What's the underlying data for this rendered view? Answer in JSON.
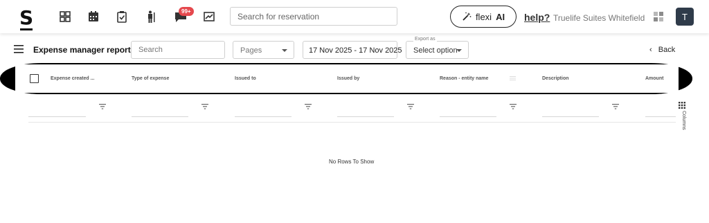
{
  "topbar": {
    "logo": "S",
    "notification_count": "99+",
    "search_placeholder": "Search for reservation",
    "flexi_prefix": "flexi",
    "flexi_suffix": "AI",
    "help_label": "help?",
    "property_name": "Truelife Suites Whitefield",
    "avatar_initial": "T",
    "icons": [
      "dashboard-icon",
      "calendar-icon",
      "clipboard-check-icon",
      "housekeeping-icon",
      "chat-icon",
      "reports-icon",
      "apps-grid-icon"
    ]
  },
  "toolbar": {
    "title": "Expense manager report",
    "search_placeholder": "Search",
    "pages_label": "Pages",
    "date_range": "17 Nov 2025 - 17 Nov 2025",
    "export_label": "Export as",
    "export_value": "Select option",
    "back_label": "Back"
  },
  "table": {
    "columns": [
      "Expense created ...",
      "Type of expense",
      "Issued to",
      "Issued by",
      "Reason - entity name",
      "Description",
      "Amount"
    ],
    "side_panel_label": "Columns",
    "empty_message": "No Rows To Show"
  },
  "colors": {
    "badge": "#e5484d",
    "avatar": "#2f3b4a",
    "header_band": "#000000"
  }
}
